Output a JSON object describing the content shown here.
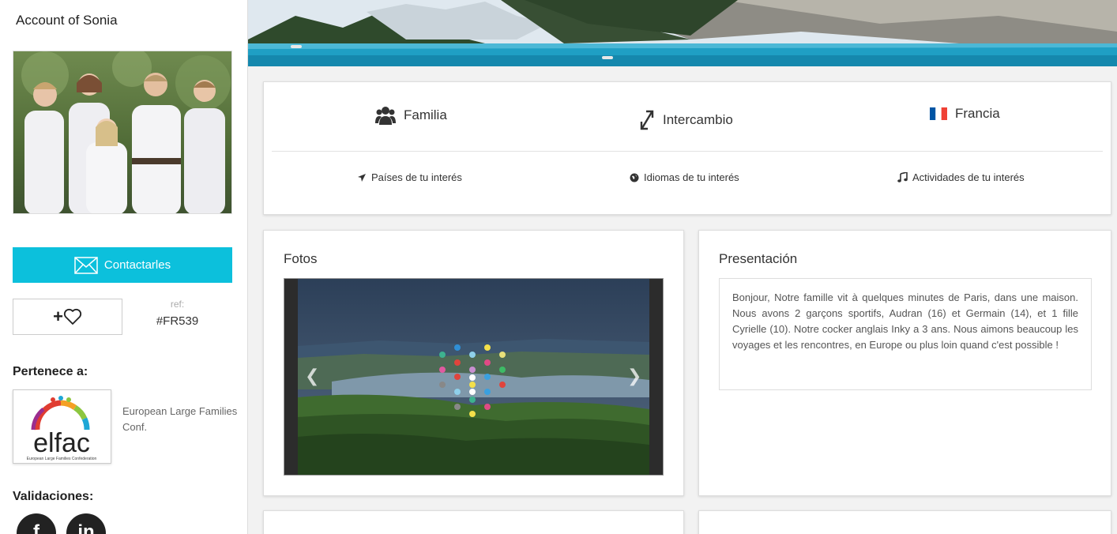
{
  "sidebar": {
    "account_title": "Account of Sonia",
    "contact_label": "Contactarles",
    "fav_label": "+",
    "ref_label": "ref:",
    "ref_value": "#FR539",
    "belongs_title": "Pertenece a:",
    "org_logo_text": "elfac",
    "org_logo_subtext": "European Large Families Confederation",
    "org_name": "European Large Families Conf.",
    "validations_title": "Validaciones:",
    "social": [
      {
        "label": "f",
        "icon": "facebook-icon"
      },
      {
        "label": "in",
        "icon": "linkedin-icon"
      }
    ]
  },
  "info": {
    "type": "Familia",
    "mode": "Intercambio",
    "country": "Francia",
    "links": [
      {
        "label": "Países de tu interés",
        "icon": "plane-icon"
      },
      {
        "label": "Idiomas de tu interés",
        "icon": "globe-icon"
      },
      {
        "label": "Actividades de tu interés",
        "icon": "music-icon"
      }
    ]
  },
  "photos": {
    "title": "Fotos"
  },
  "presentation": {
    "title": "Presentación",
    "text": "Bonjour, Notre famille vit à quelques minutes de Paris, dans une maison. Nous avons 2 garçons sportifs, Audran (16) et Germain (14), et 1 fille Cyrielle (10). Notre cocker anglais Inky a 3 ans. Nous aimons beaucoup les voyages et les rencontres, en Europe ou plus loin quand c'est possible !"
  },
  "colors": {
    "accent": "#0cc0dc",
    "dark": "#222222"
  }
}
